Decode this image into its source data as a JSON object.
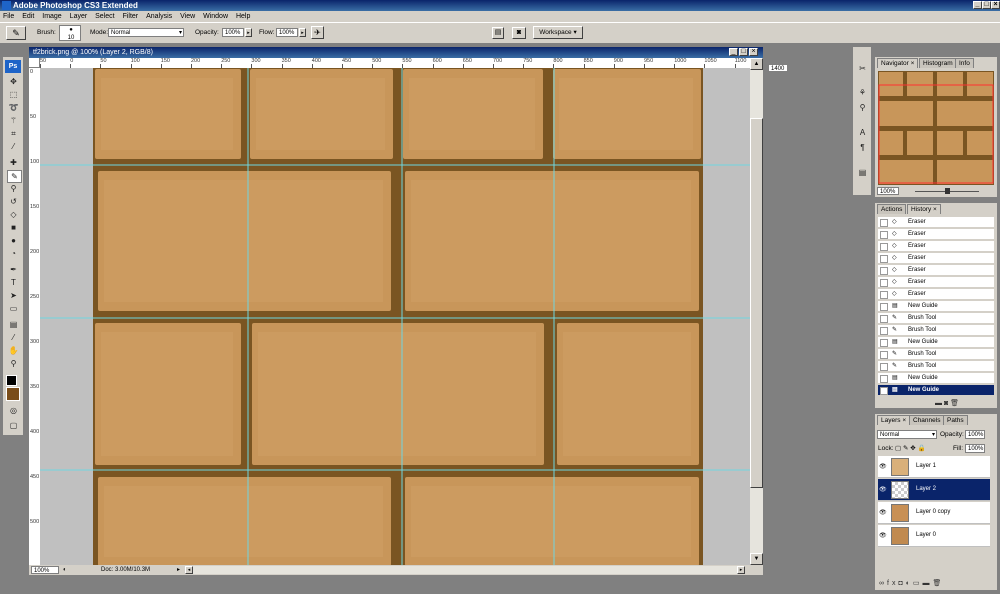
{
  "app": {
    "title": "Adobe Photoshop CS3 Extended",
    "logo": "Ps"
  },
  "menu": [
    "File",
    "Edit",
    "Image",
    "Layer",
    "Select",
    "Filter",
    "Analysis",
    "View",
    "Window",
    "Help"
  ],
  "options": {
    "brush_label": "Brush:",
    "brush_size": "10",
    "mode_label": "Mode:",
    "mode_value": "Normal",
    "opacity_label": "Opacity:",
    "opacity_value": "100%",
    "flow_label": "Flow:",
    "flow_value": "100%",
    "workspace_label": "Workspace"
  },
  "document": {
    "title": "tf2brick.png @ 100% (Layer 2, RGB/8)",
    "zoom": "100%",
    "doc_info": "Doc: 3.00M/10.3M",
    "ruler_h": [
      "50",
      "0",
      "50",
      "100",
      "150",
      "200",
      "250",
      "300",
      "350",
      "400",
      "450",
      "500",
      "550",
      "600",
      "650",
      "700",
      "750",
      "800",
      "850",
      "900",
      "950",
      "1000",
      "1050",
      "1100"
    ],
    "ruler_v": [
      "0",
      "50",
      "100",
      "150",
      "200",
      "250",
      "300",
      "350",
      "400",
      "450",
      "500"
    ],
    "brick_color": "#c8965a",
    "mortar_color": "#7a5522",
    "guide_color": "#6fd6e0"
  },
  "navigator": {
    "tabs": [
      "Navigator",
      "Histogram",
      "Info"
    ],
    "zoom": "100%",
    "extra_field": "1400"
  },
  "history": {
    "tabs": [
      "Actions",
      "History"
    ],
    "items": [
      "Eraser",
      "Eraser",
      "Eraser",
      "Eraser",
      "Eraser",
      "Eraser",
      "Eraser",
      "New Guide",
      "Brush Tool",
      "Brush Tool",
      "New Guide",
      "Brush Tool",
      "Brush Tool",
      "New Guide",
      "New Guide"
    ]
  },
  "layers": {
    "tabs": [
      "Layers",
      "Channels",
      "Paths"
    ],
    "blend_mode": "Normal",
    "opacity_label": "Opacity:",
    "opacity_value": "100%",
    "lock_label": "Lock:",
    "fill_label": "Fill:",
    "fill_value": "100%",
    "items": [
      "Layer 1",
      "Layer 2",
      "Layer 0 copy",
      "Layer 0"
    ],
    "selected": "Layer 2"
  }
}
